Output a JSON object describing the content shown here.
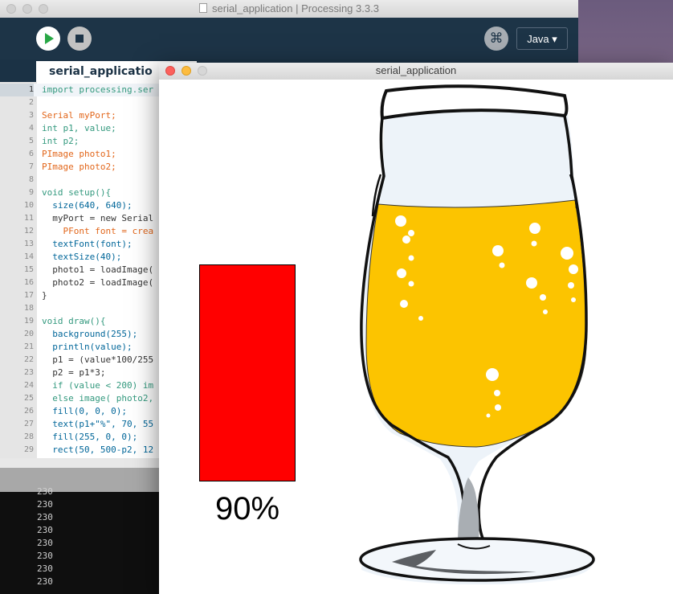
{
  "ide": {
    "title": "serial_application | Processing 3.3.3",
    "mode": "Java ▾",
    "tab": "serial_applicatio",
    "debug_glyph": "⌘",
    "code_lines": [
      {
        "n": "1",
        "t": "import processing.ser"
      },
      {
        "n": "2",
        "t": ""
      },
      {
        "n": "3",
        "t": "Serial myPort;"
      },
      {
        "n": "4",
        "t": "int p1, value;"
      },
      {
        "n": "5",
        "t": "int p2;"
      },
      {
        "n": "6",
        "t": "PImage photo1;"
      },
      {
        "n": "7",
        "t": "PImage photo2;"
      },
      {
        "n": "8",
        "t": ""
      },
      {
        "n": "9",
        "t": "void setup(){"
      },
      {
        "n": "10",
        "t": "  size(640, 640);"
      },
      {
        "n": "11",
        "t": "  myPort = new Serial"
      },
      {
        "n": "12",
        "t": "    PFont font = crea"
      },
      {
        "n": "13",
        "t": "  textFont(font);"
      },
      {
        "n": "14",
        "t": "  textSize(40);"
      },
      {
        "n": "15",
        "t": "  photo1 = loadImage("
      },
      {
        "n": "16",
        "t": "  photo2 = loadImage("
      },
      {
        "n": "17",
        "t": "}"
      },
      {
        "n": "18",
        "t": ""
      },
      {
        "n": "19",
        "t": "void draw(){"
      },
      {
        "n": "20",
        "t": "  background(255);"
      },
      {
        "n": "21",
        "t": "  println(value);"
      },
      {
        "n": "22",
        "t": "  p1 = (value*100/255"
      },
      {
        "n": "23",
        "t": "  p2 = p1*3;"
      },
      {
        "n": "24",
        "t": "  if (value < 200) im"
      },
      {
        "n": "25",
        "t": "  else image( photo2,"
      },
      {
        "n": "26",
        "t": "  fill(0, 0, 0);"
      },
      {
        "n": "27",
        "t": "  text(p1+\"%\", 70, 55"
      },
      {
        "n": "28",
        "t": "  fill(255, 0, 0);"
      },
      {
        "n": "29",
        "t": "  rect(50, 500-p2, 12"
      }
    ],
    "console_lines": [
      "230",
      "230",
      "230",
      "230",
      "230",
      "230",
      "230",
      "230"
    ]
  },
  "sketch": {
    "title": "serial_application",
    "level_label": "90%",
    "level_fraction": 0.9,
    "bar_color": "#ff0000",
    "beer_color": "#fcc400"
  }
}
